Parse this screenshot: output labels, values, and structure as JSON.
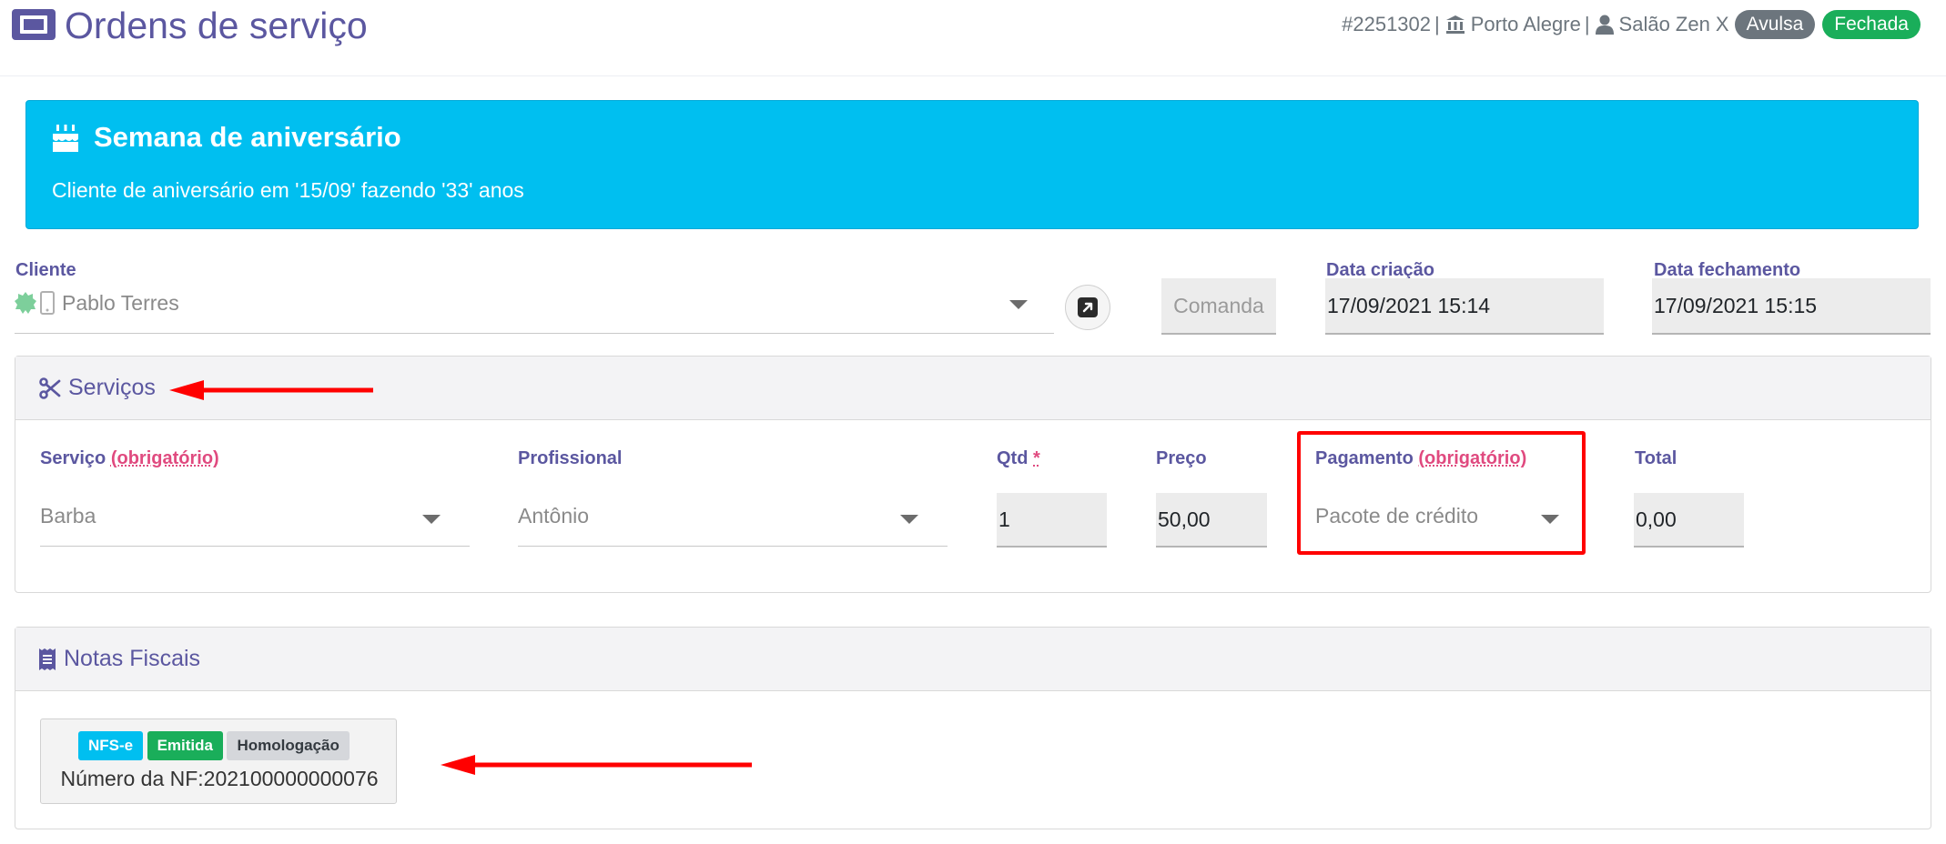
{
  "header": {
    "title": "Ordens de serviço",
    "order_number": "#2251302",
    "separator": "|",
    "unit": "Porto Alegre",
    "company": "Salão Zen X",
    "badge_type": "Avulsa",
    "badge_status": "Fechada"
  },
  "alert": {
    "title": "Semana de aniversário",
    "text": "Cliente de aniversário em '15/09' fazendo '33' anos"
  },
  "client": {
    "label": "Cliente",
    "value": "Pablo Terres"
  },
  "comanda": {
    "placeholder": "Comanda"
  },
  "dates": {
    "created_label": "Data criação",
    "created_value": "17/09/2021 15:14",
    "closed_label": "Data fechamento",
    "closed_value": "17/09/2021 15:15"
  },
  "services": {
    "title": "Serviços",
    "service_label": "Serviço",
    "required_text": "(obrigatório)",
    "service_value": "Barba",
    "professional_label": "Profissional",
    "professional_value": "Antônio",
    "qty_label": "Qtd",
    "qty_required": "*",
    "qty_value": "1",
    "price_label": "Preço",
    "price_value": "50,00",
    "payment_label": "Pagamento",
    "payment_value": "Pacote de crédito",
    "total_label": "Total",
    "total_value": "0,00"
  },
  "invoices": {
    "title": "Notas Fiscais",
    "badge_type": "NFS-e",
    "badge_status": "Emitida",
    "badge_env": "Homologação",
    "number_text": "Número da NF:202100000000076"
  },
  "icons": [
    "ticket-icon",
    "institution-icon",
    "user-icon",
    "birthday-cake-icon",
    "badge-icon",
    "mobile-icon",
    "external-link-icon",
    "scissors-icon",
    "receipt-icon",
    "caret-down-icon"
  ],
  "colors": {
    "primary": "#5b57a0",
    "alert_bg": "#00bff0",
    "success": "#1aae5a",
    "secondary": "#6c757d",
    "required": "#e04a7f",
    "annotation": "#ff0000"
  }
}
